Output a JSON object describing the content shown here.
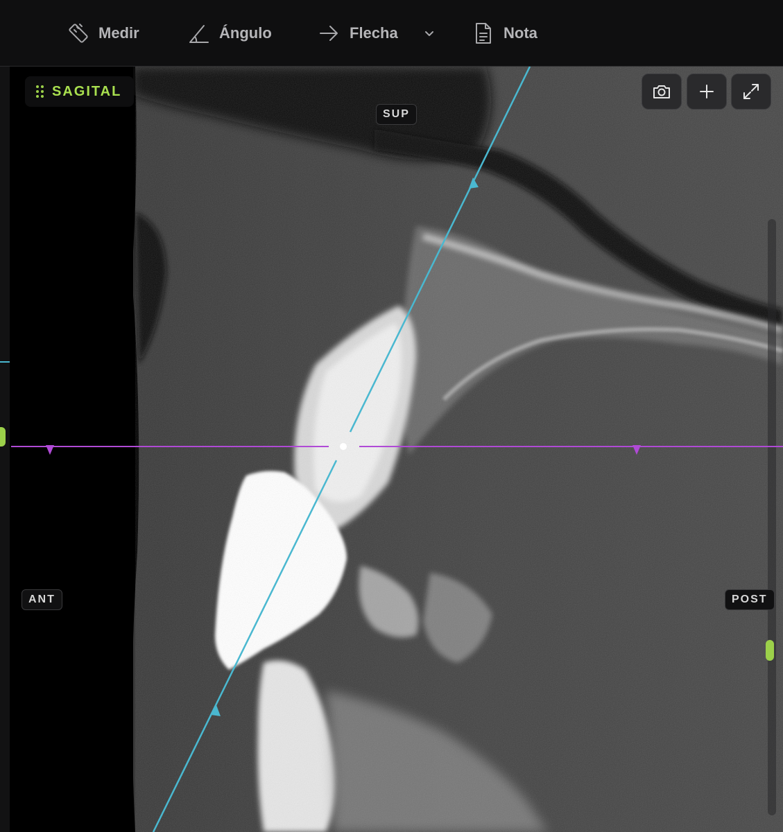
{
  "toolbar": {
    "measure_label": "Medir",
    "angle_label": "Ángulo",
    "arrow_label": "Flecha",
    "note_label": "Nota"
  },
  "viewport": {
    "view_name": "SAGITAL",
    "orientation": {
      "superior": "SUP",
      "anterior": "ANT",
      "posterior": "POST"
    }
  },
  "icons": {
    "measure": "ruler-icon",
    "angle": "angle-icon",
    "arrow": "arrow-right-icon",
    "arrow_menu": "chevron-down-icon",
    "note": "document-icon",
    "snapshot": "camera-icon",
    "add": "plus-icon",
    "fullscreen": "expand-icon",
    "view_handle": "drag-handle-icon"
  },
  "colors": {
    "accent": "#9cd14a",
    "view_label": "#a9e04f",
    "axial_line": "#b04ad6",
    "axis_line": "#4ab8d0",
    "toolbar_bg": "#0f0f10",
    "button_bg": "#2a2a2c"
  }
}
